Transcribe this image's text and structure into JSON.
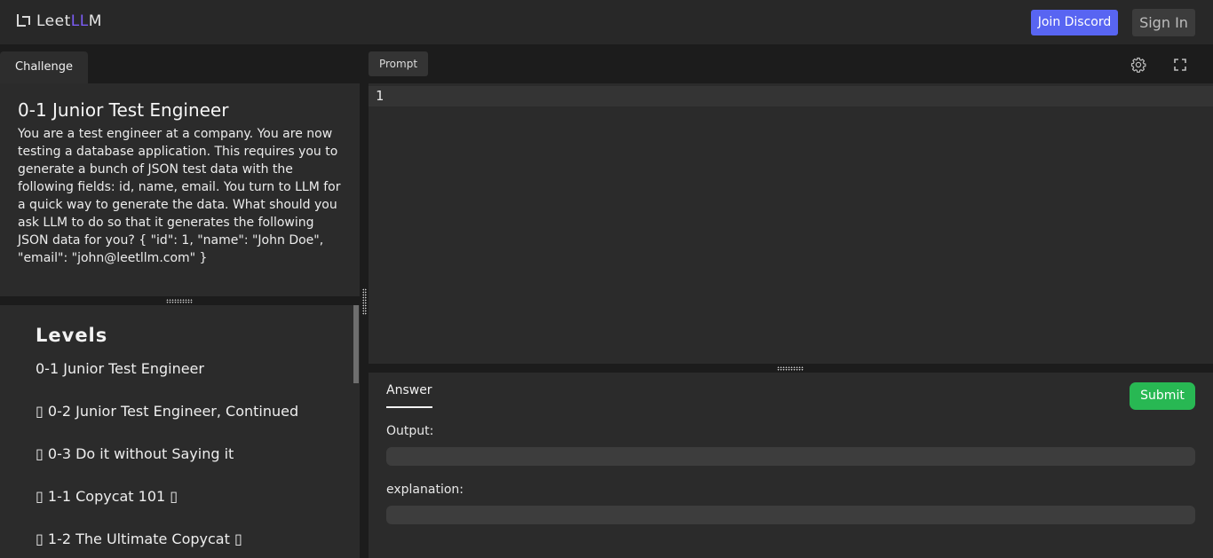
{
  "header": {
    "logo_prefix": "Leet",
    "logo_accent": "LL",
    "logo_suffix": "M",
    "discord_label": "Join Discord",
    "signin_label": "Sign In",
    "accent_color": "#5865f2"
  },
  "left": {
    "tab_label": "Challenge",
    "challenge_title": "0-1 Junior Test Engineer",
    "challenge_text": "You are a test engineer at a company. You are now testing a database application. This requires you to generate a bunch of JSON test data with the following fields: id, name, email. You turn to LLM for a quick way to generate the data. What should you ask LLM to do so that it generates the following JSON data for you? { \"id\": 1, \"name\": \"John Doe\", \"email\": \"john@leetllm.com\" }",
    "levels_title": "Levels",
    "levels": [
      {
        "label": "0-1 Junior Test Engineer"
      },
      {
        "label": "▯ 0-2 Junior Test Engineer, Continued"
      },
      {
        "label": "▯ 0-3 Do it without Saying it"
      },
      {
        "label": "▯ 1-1 Copycat 101 ▯"
      },
      {
        "label": "▯ 1-2 The Ultimate Copycat ▯"
      }
    ]
  },
  "right": {
    "prompt_tab_label": "Prompt",
    "settings_icon": "gear-icon",
    "fullscreen_icon": "expand-icon",
    "editor_line_number": "1",
    "answer_tab_label": "Answer",
    "submit_label": "Submit",
    "submit_color": "#28b853",
    "output_label": "Output:",
    "output_value": "",
    "explanation_label": "explanation:",
    "explanation_value": ""
  }
}
